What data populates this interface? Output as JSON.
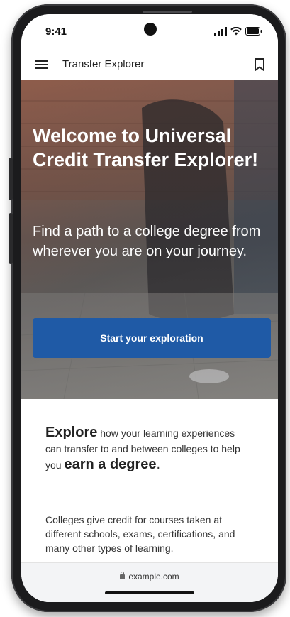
{
  "status_bar": {
    "time": "9:41"
  },
  "app_bar": {
    "title": "Transfer Explorer",
    "menu_icon": "hamburger-menu-icon",
    "bookmark_icon": "bookmark-icon"
  },
  "hero": {
    "title": "Welcome to Universal Credit Transfer Explorer!",
    "subtitle": "Find a path to a college degree from wherever you are on your journey.",
    "cta_label": "Start your exploration"
  },
  "content": {
    "explore_lead": "Explore",
    "explore_mid": " how your learning experiences can transfer to and between colleges to help you ",
    "explore_strong": "earn a degree",
    "explore_end": ".",
    "colleges_text": "Colleges give credit for courses taken at different schools, exams, certifications, and many other types of learning."
  },
  "browser": {
    "url": "example.com"
  },
  "colors": {
    "cta": "#1f5aa6",
    "hero_text": "#ffffff",
    "body_text": "#333333"
  }
}
